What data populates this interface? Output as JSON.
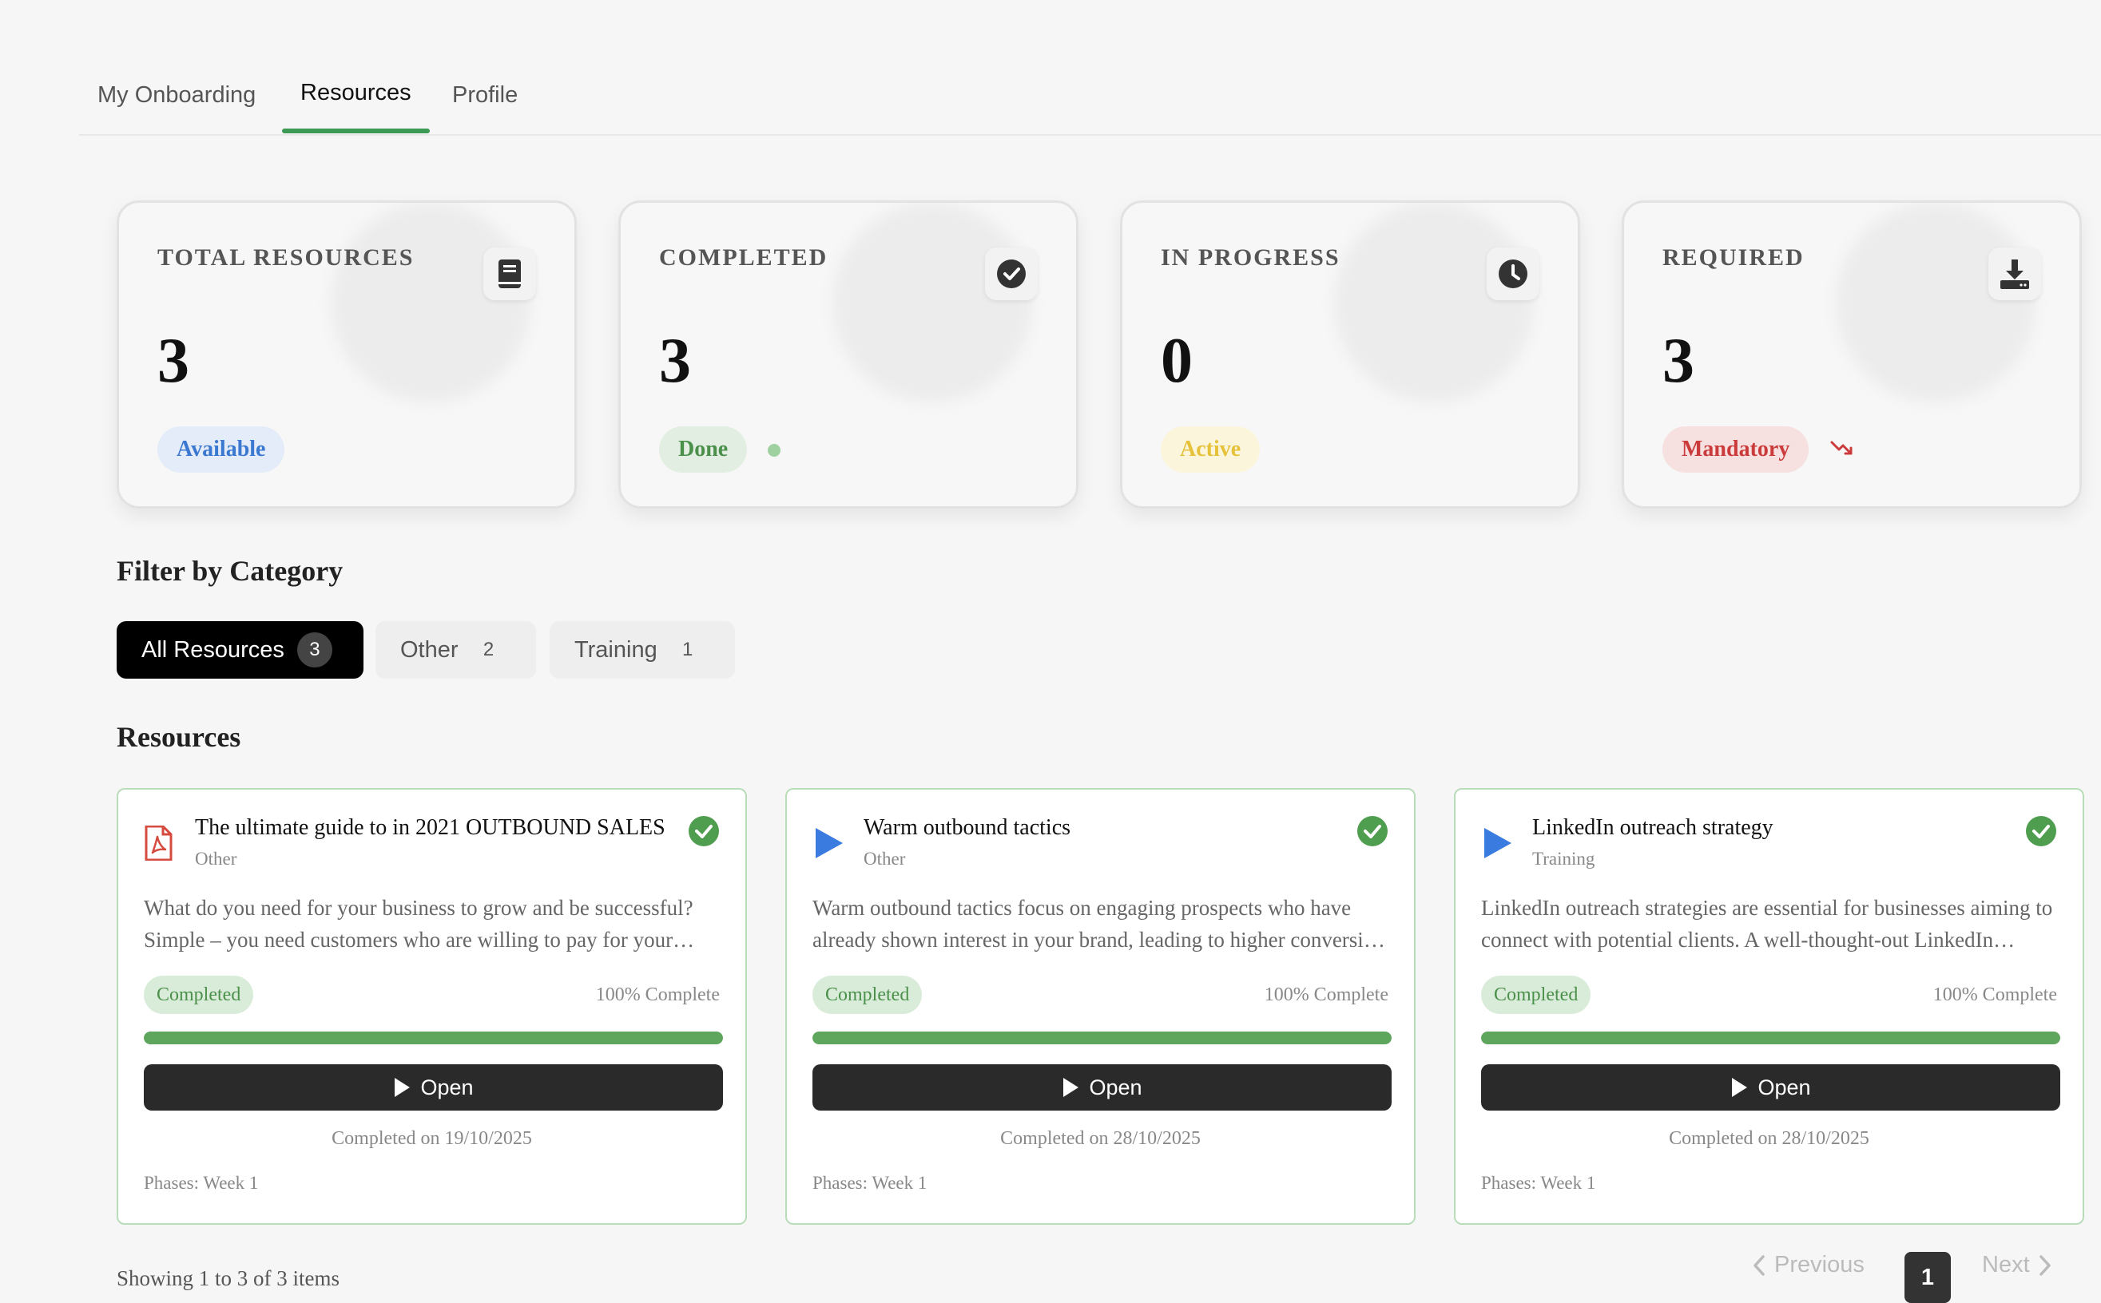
{
  "tabs": [
    {
      "label": "My Onboarding"
    },
    {
      "label": "Resources"
    },
    {
      "label": "Profile"
    }
  ],
  "stats": [
    {
      "label": "TOTAL RESOURCES",
      "value": "3",
      "pill": "Available",
      "icon": "book-icon"
    },
    {
      "label": "COMPLETED",
      "value": "3",
      "pill": "Done",
      "icon": "check-circle-icon"
    },
    {
      "label": "IN PROGRESS",
      "value": "0",
      "pill": "Active",
      "icon": "clock-icon"
    },
    {
      "label": "REQUIRED",
      "value": "3",
      "pill": "Mandatory",
      "icon": "download-icon",
      "trend_icon": "trending-down-icon"
    }
  ],
  "filter": {
    "heading": "Filter by Category",
    "chips": [
      {
        "label": "All Resources",
        "count": "3"
      },
      {
        "label": "Other",
        "count": "2"
      },
      {
        "label": "Training",
        "count": "1"
      }
    ]
  },
  "resources": {
    "heading": "Resources",
    "open_label": "Open",
    "items": [
      {
        "title": "The ultimate guide to in 2021 OUTBOUND SALES",
        "category": "Other",
        "icon": "pdf-icon",
        "description": "What do you need for your business to grow and be successful? Simple – you need customers who are willing to pay for your products and services.",
        "status": "Completed",
        "progress_label": "100% Complete",
        "progress": 100,
        "completed_on": "Completed on 19/10/2025",
        "phases": "Phases: Week 1"
      },
      {
        "title": "Warm outbound tactics",
        "category": "Other",
        "icon": "video-play-icon",
        "description": "Warm outbound tactics focus on engaging prospects who have already shown interest in your brand, leading to higher conversion rates.",
        "status": "Completed",
        "progress_label": "100% Complete",
        "progress": 100,
        "completed_on": "Completed on 28/10/2025",
        "phases": "Phases: Week 1"
      },
      {
        "title": "LinkedIn outreach strategy",
        "category": "Training",
        "icon": "video-play-icon",
        "description": "LinkedIn outreach strategies are essential for businesses aiming to connect with potential clients. A well-thought-out LinkedIn strategy can open doors.",
        "status": "Completed",
        "progress_label": "100% Complete",
        "progress": 100,
        "completed_on": "Completed on 28/10/2025",
        "phases": "Phases: Week 1"
      }
    ]
  },
  "footer": {
    "showing": "Showing 1 to 3 of 3 items",
    "previous": "Previous",
    "page": "1",
    "next": "Next"
  },
  "colors": {
    "accent": "#3d9a55",
    "progress": "#5ea55e",
    "blue": "#3b78d0",
    "red": "#cc3b3b",
    "yellow": "#e6c23a"
  }
}
